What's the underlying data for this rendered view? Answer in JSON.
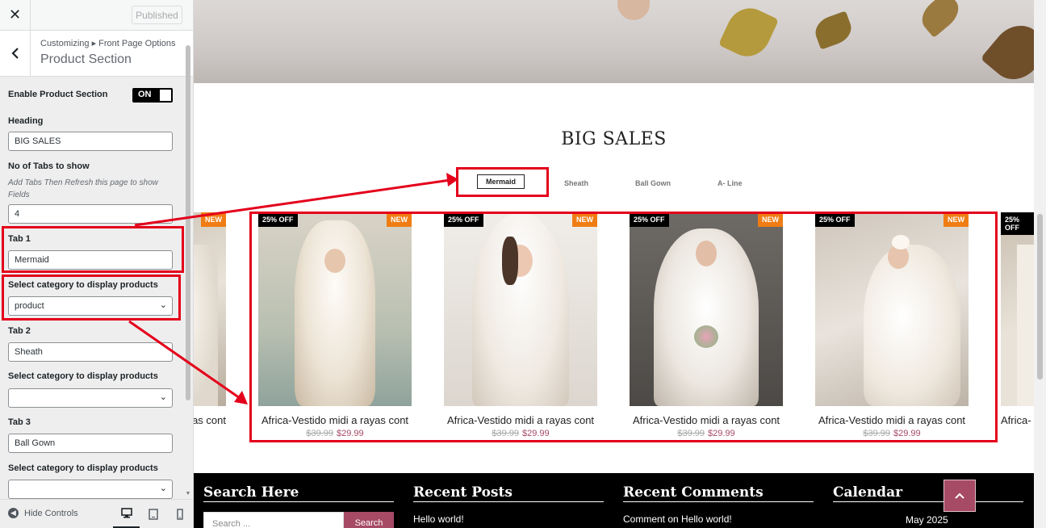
{
  "sidebar": {
    "published_label": "Published",
    "breadcrumb": "Customizing ▸ Front Page Options",
    "section_title": "Product Section",
    "enable_label": "Enable Product Section",
    "toggle_text": "ON",
    "heading_label": "Heading",
    "heading_value": "BIG SALES",
    "num_tabs_label": "No of Tabs to show",
    "num_tabs_note": "Add Tabs Then Refresh this page to show Fields",
    "num_tabs_value": "4",
    "tab1_label": "Tab 1",
    "tab1_value": "Mermaid",
    "cat1_label": "Select category to display products",
    "cat1_value": "product",
    "tab2_label": "Tab 2",
    "tab2_value": "Sheath",
    "cat2_label": "Select category to display products",
    "cat2_value": "",
    "tab3_label": "Tab 3",
    "tab3_value": "Ball Gown",
    "cat3_label": "Select category to display products",
    "cat3_value": "",
    "hide_controls": "Hide Controls",
    "icons": [
      "close-icon",
      "back-chevron-icon",
      "desktop-icon",
      "tablet-icon",
      "mobile-icon"
    ]
  },
  "preview": {
    "section_heading": "BIG SALES",
    "tabs": [
      "Mermaid",
      "Sheath",
      "Ball Gown",
      "A- Line"
    ],
    "partial_left_name": "as cont",
    "partial_left_badge": "NEW",
    "partial_right_name": "Africa-",
    "partial_right_badge": "25% OFF",
    "products": [
      {
        "name": "Africa-Vestido midi a rayas cont",
        "old_price": "$39.99",
        "price": "$29.99",
        "discount": "25% OFF",
        "badge": "NEW"
      },
      {
        "name": "Africa-Vestido midi a rayas cont",
        "old_price": "$39.99",
        "price": "$29.99",
        "discount": "25% OFF",
        "badge": "NEW"
      },
      {
        "name": "Africa-Vestido midi a rayas cont",
        "old_price": "$39.99",
        "price": "$29.99",
        "discount": "25% OFF",
        "badge": "NEW"
      },
      {
        "name": "Africa-Vestido midi a rayas cont",
        "old_price": "$39.99",
        "price": "$29.99",
        "discount": "25% OFF",
        "badge": "NEW"
      }
    ],
    "footer": {
      "search_title": "Search Here",
      "search_placeholder": "Search ...",
      "search_button": "Search",
      "posts_title": "Recent Posts",
      "posts_item": "Hello world!",
      "comments_title": "Recent Comments",
      "comments_item": "Comment on Hello world!",
      "calendar_title": "Calendar",
      "calendar_month": "May 2025"
    }
  },
  "colors": {
    "accent": "#a64a66",
    "annotation": "#e4001b",
    "new_badge": "#f07d14"
  }
}
